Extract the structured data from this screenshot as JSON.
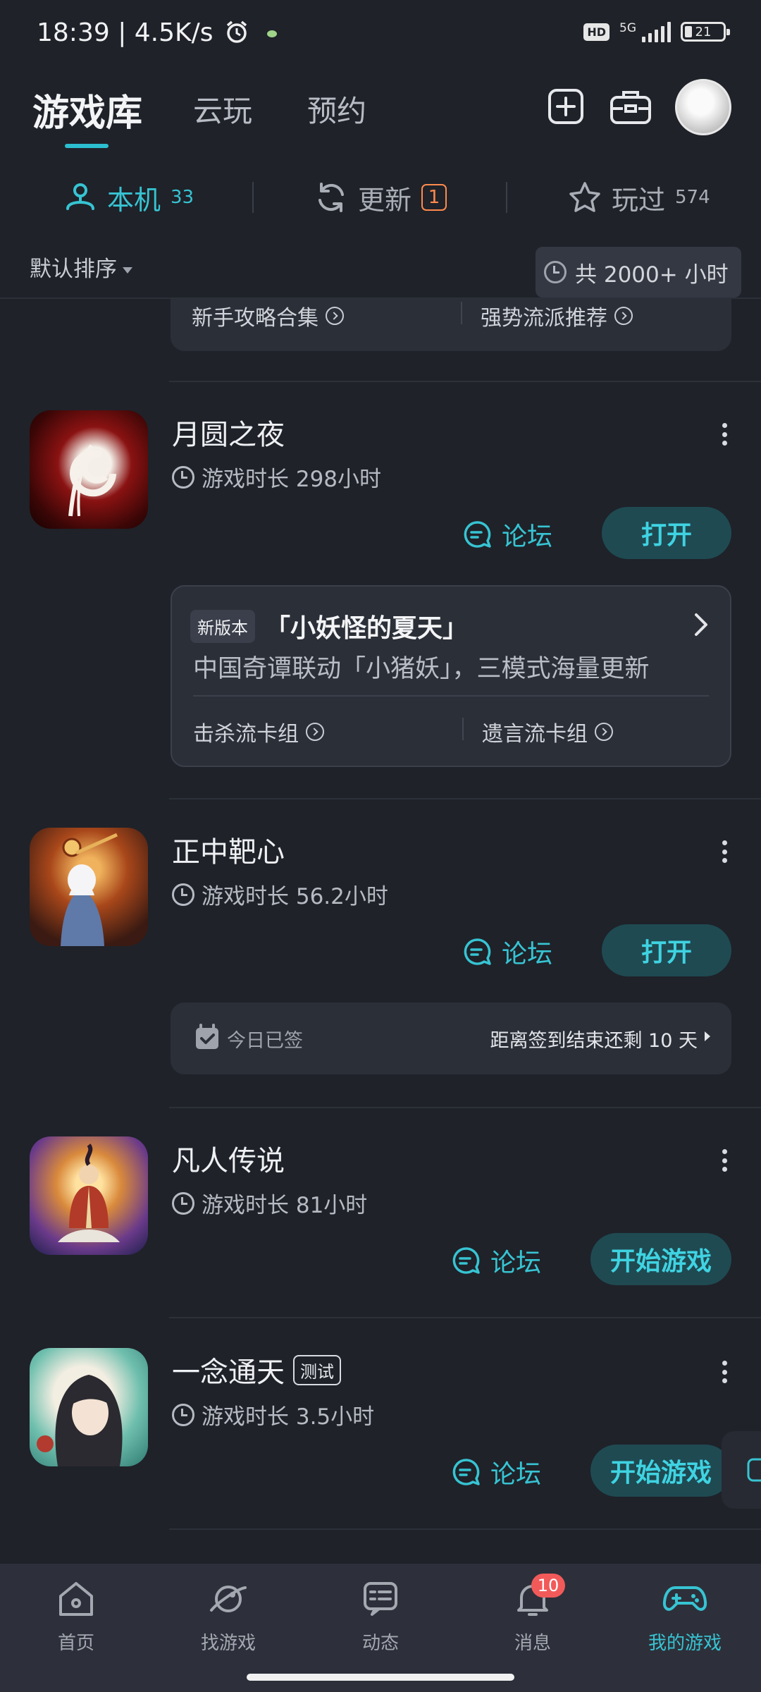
{
  "status_bar": {
    "time": "18:39",
    "network_speed": "4.5K/s",
    "hd": "HD",
    "network": "5G",
    "battery": "21"
  },
  "header": {
    "tabs": [
      "游戏库",
      "云玩",
      "预约"
    ],
    "active_tab": 0
  },
  "segments": {
    "local_label": "本机",
    "local_count": "33",
    "update_label": "更新",
    "update_count": "1",
    "played_label": "玩过",
    "played_count": "574"
  },
  "sort": {
    "label": "默认排序"
  },
  "total_hours": "共 2000+ 小时",
  "top_card": {
    "link_left": "新手攻略合集",
    "link_right": "强势流派推荐"
  },
  "games": [
    {
      "name": "月圆之夜",
      "playtime": "游戏时长 298小时",
      "forum": "论坛",
      "action": "打开"
    },
    {
      "name": "正中靶心",
      "playtime": "游戏时长 56.2小时",
      "forum": "论坛",
      "action": "打开"
    },
    {
      "name": "凡人传说",
      "playtime": "游戏时长 81小时",
      "forum": "论坛",
      "action": "开始游戏"
    },
    {
      "name": "一念通天",
      "tag": "测试",
      "playtime": "游戏时长 3.5小时",
      "forum": "论坛",
      "action": "开始游戏"
    }
  ],
  "version_card": {
    "tag": "新版本",
    "title": "「小妖怪的夏天」",
    "desc": "中国奇谭联动「小猪妖」，三模式海量更新",
    "link_left": "击杀流卡组",
    "link_right": "遗言流卡组"
  },
  "checkin": {
    "status": "今日已签",
    "remaining": "距离签到结束还剩 10 天"
  },
  "bottom_nav": {
    "items": [
      "首页",
      "找游戏",
      "动态",
      "消息",
      "我的游戏"
    ],
    "active": 4,
    "message_badge": "10"
  },
  "colors": {
    "accent": "#37c4d3",
    "background": "#1f2229",
    "card": "#2b2f38",
    "update_badge": "#ff8a4c",
    "notification_badge": "#f25a5a"
  }
}
